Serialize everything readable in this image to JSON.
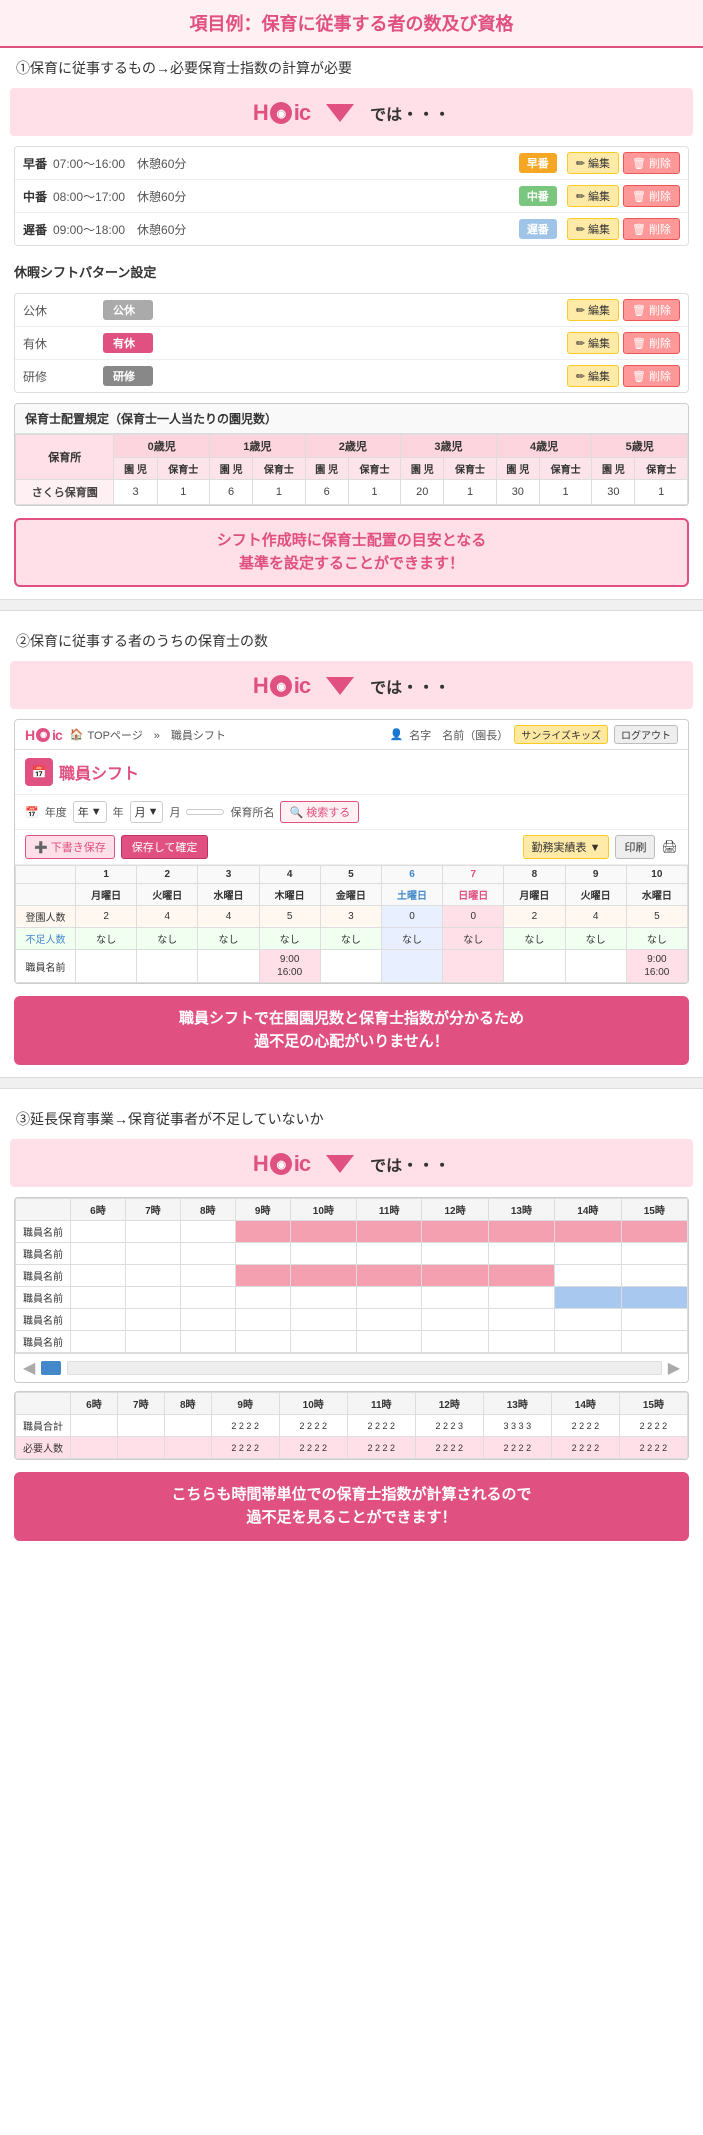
{
  "page": {
    "title": "項目例：保育に従事する者の数及び資格",
    "section1_intro": "①保育に従事するもの→必要保育士指数の計算が必要",
    "section2_intro": "②保育に従事する者のうちの保育士の数",
    "section3_intro": "③延長保育事業→保育従事者が不足していないか",
    "hoic_text": "では・・・",
    "arrow": "▼"
  },
  "shifts": [
    {
      "id": "hayam",
      "label": "早番",
      "time": "07:00～16:00　休憩60分",
      "badge": "早番",
      "badgeClass": "badge-hayam"
    },
    {
      "id": "chuhan",
      "label": "中番",
      "time": "08:00～17:00　休憩60分",
      "badge": "中番",
      "badgeClass": "badge-chuhan"
    },
    {
      "id": "oban",
      "label": "遅番",
      "time": "09:00～18:00　休憩60分",
      "badge": "遅番",
      "badgeClass": "badge-oban"
    }
  ],
  "patterns": {
    "title": "休暇シフトパターン設定",
    "items": [
      {
        "label": "公休",
        "badge": "公休",
        "badgeClass": "badge-kokai"
      },
      {
        "label": "有休",
        "badge": "有休",
        "badgeClass": "badge-yukyu"
      },
      {
        "label": "研修",
        "badge": "研修",
        "badgeClass": "badge-kenshu"
      }
    ]
  },
  "alloc": {
    "title": "保育士配置規定（保育士一人当たりの園児数）",
    "col_headers": [
      "保育所",
      "0歳児",
      "1歳児",
      "2歳児",
      "3歳児",
      "4歳児",
      "5歳児"
    ],
    "sub_headers": [
      "園 児",
      "保育士",
      "園 児",
      "保育士",
      "園 児",
      "保育士",
      "園 児",
      "保育士",
      "園 児",
      "保育士",
      "園 児",
      "保育士"
    ],
    "row": {
      "name": "さくら保育園",
      "values": [
        3,
        1,
        6,
        1,
        6,
        1,
        20,
        1,
        30,
        1,
        30,
        1
      ]
    }
  },
  "message1": {
    "line1": "シフト作成時に保育士配置の目安となる",
    "line2": "基準を設定することができます！"
  },
  "mockup": {
    "nav": "TOPページ　»　職員シフト",
    "user": "名字　名前（園長）",
    "sunrise": "サンライズキッズ",
    "logout": "ログアウト",
    "title": "職員シフト",
    "year_label": "年度",
    "year_placeholder": "年",
    "month_placeholder": "月",
    "nursery_label": "保育所名",
    "search_btn": "検索する",
    "dl_btn": "下書き保存",
    "save_btn": "保存して確定",
    "jisseki_btn": "勤務実績表 ▼",
    "print_btn": "印刷",
    "days": [
      "1",
      "2",
      "3",
      "4",
      "5",
      "6",
      "7",
      "8",
      "9",
      "10"
    ],
    "day_labels": [
      "月曜日",
      "火曜日",
      "水曜日",
      "木曜日",
      "金曜日",
      "土曜日",
      "日曜日",
      "月曜日",
      "火曜日",
      "水曜日"
    ],
    "row_torokusuu": [
      "登園人数",
      "2",
      "4",
      "4",
      "5",
      "3",
      "0",
      "0",
      "2",
      "4",
      "5"
    ],
    "row_fusokusuu": [
      "不足人数",
      "なし",
      "なし",
      "なし",
      "なし",
      "なし",
      "なし",
      "なし",
      "なし",
      "なし",
      "なし"
    ],
    "row_shain": "職員名前",
    "shift_time1": "9:00\n16:00",
    "shift_time2": "9:00\n16:00"
  },
  "message2": {
    "line1": "職員シフトで在園園児数と保育士指数が分かるため",
    "line2": "過不足の心配がいりません！"
  },
  "timeline": {
    "hours": [
      "6時",
      "7時",
      "8時",
      "9時",
      "10時",
      "11時",
      "12時",
      "13時",
      "14時",
      "15時"
    ],
    "rows": [
      {
        "name": "職員名前",
        "cells": [
          "",
          "",
          "",
          "pink",
          "pink",
          "pink",
          "pink",
          "pink",
          "pink",
          "pink"
        ]
      },
      {
        "name": "職員名前",
        "cells": [
          "",
          "",
          "",
          "",
          "",
          "",
          "",
          "",
          "",
          ""
        ]
      },
      {
        "name": "職員名前",
        "cells": [
          "",
          "",
          "",
          "pink",
          "pink",
          "pink",
          "pink",
          "pink",
          "",
          ""
        ]
      },
      {
        "name": "職員名前",
        "cells": [
          "",
          "",
          "",
          "",
          "",
          "",
          "",
          "",
          "blue",
          "blue"
        ]
      },
      {
        "name": "職員名前",
        "cells": [
          "",
          "",
          "",
          "",
          "",
          "",
          "",
          "",
          "",
          ""
        ]
      },
      {
        "name": "職員名前",
        "cells": [
          "",
          "",
          "",
          "",
          "",
          "",
          "",
          "",
          "",
          ""
        ]
      }
    ]
  },
  "summary": {
    "hours": [
      "6時",
      "7時",
      "8時",
      "9時",
      "10時",
      "11時",
      "12時",
      "13時",
      "14時",
      "15時"
    ],
    "row_gokei": {
      "label": "職員合計",
      "values": [
        "",
        "",
        "",
        "2",
        "2",
        "2",
        "2",
        "2",
        "2",
        "2",
        "2",
        "2",
        "2",
        "2",
        "2",
        "2",
        "3",
        "3",
        "3",
        "3",
        "2",
        "2",
        "2",
        "2",
        "2",
        "2"
      ]
    },
    "row_hitsuyou": {
      "label": "必要人数",
      "values": [
        "",
        "",
        "",
        "2",
        "2",
        "2",
        "2",
        "2",
        "2",
        "2",
        "2",
        "2",
        "2",
        "2",
        "2",
        "2",
        "2",
        "2",
        "2",
        "2",
        "2",
        "2",
        "2",
        "2",
        "2",
        "2"
      ]
    }
  },
  "message3": {
    "line1": "こちらも時間帯単位での保育士指数が計算されるので",
    "line2": "過不足を見ることができます！"
  },
  "buttons": {
    "edit": "編集",
    "delete": "削除"
  }
}
